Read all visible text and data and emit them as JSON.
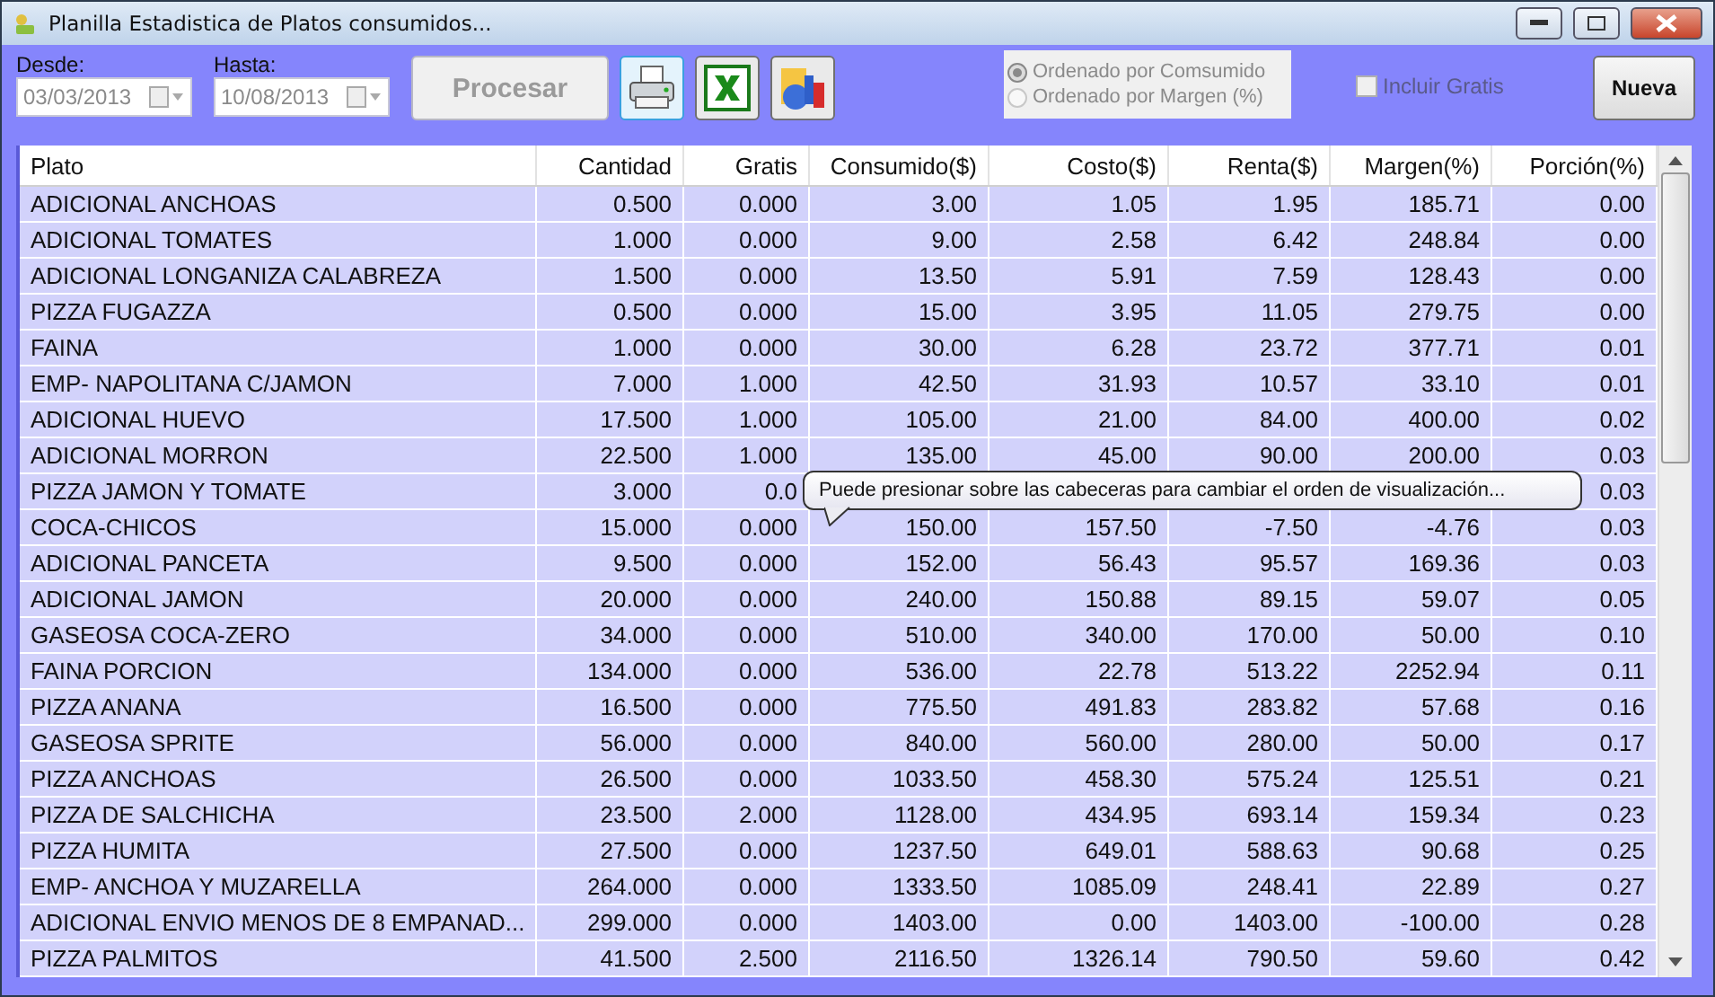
{
  "window": {
    "title": "Planilla Estadistica de Platos consumidos..."
  },
  "filters": {
    "from": {
      "label": "Desde:",
      "value": "03/03/2013",
      "disabled": true
    },
    "to": {
      "label": "Hasta:",
      "value": "10/08/2013",
      "disabled": true
    }
  },
  "process_button": {
    "label": "Procesar",
    "disabled": true
  },
  "tool_buttons": [
    {
      "kind": "print",
      "selected": true
    },
    {
      "kind": "excel",
      "selected": false
    },
    {
      "kind": "chart",
      "selected": false
    }
  ],
  "order_options": [
    {
      "label": "Ordenado por Comsumido",
      "selected": true
    },
    {
      "label": "Ordenado por Margen (%)",
      "selected": false
    }
  ],
  "include_free": {
    "label": "Incluir Gratis",
    "checked": false,
    "disabled": true
  },
  "new_button": {
    "label": "Nueva"
  },
  "table": {
    "columns": [
      "Plato",
      "Cantidad",
      "Gratis",
      "Consumido($)",
      "Costo($)",
      "Renta($)",
      "Margen(%)",
      "Porción(%)"
    ],
    "rows": [
      [
        "ADICIONAL ANCHOAS",
        "0.500",
        "0.000",
        "3.00",
        "1.05",
        "1.95",
        "185.71",
        "0.00"
      ],
      [
        "ADICIONAL TOMATES",
        "1.000",
        "0.000",
        "9.00",
        "2.58",
        "6.42",
        "248.84",
        "0.00"
      ],
      [
        "ADICIONAL LONGANIZA CALABREZA",
        "1.500",
        "0.000",
        "13.50",
        "5.91",
        "7.59",
        "128.43",
        "0.00"
      ],
      [
        "PIZZA FUGAZZA",
        "0.500",
        "0.000",
        "15.00",
        "3.95",
        "11.05",
        "279.75",
        "0.00"
      ],
      [
        "FAINA",
        "1.000",
        "0.000",
        "30.00",
        "6.28",
        "23.72",
        "377.71",
        "0.01"
      ],
      [
        "EMP- NAPOLITANA C/JAMON",
        "7.000",
        "1.000",
        "42.50",
        "31.93",
        "10.57",
        "33.10",
        "0.01"
      ],
      [
        "ADICIONAL HUEVO",
        "17.500",
        "1.000",
        "105.00",
        "21.00",
        "84.00",
        "400.00",
        "0.02"
      ],
      [
        "ADICIONAL MORRON",
        "22.500",
        "1.000",
        "135.00",
        "45.00",
        "90.00",
        "200.00",
        "0.03"
      ],
      [
        "PIZZA JAMON Y TOMATE",
        "3.000",
        "0.0",
        null,
        null,
        null,
        null,
        "0.03"
      ],
      [
        "COCA-CHICOS",
        "15.000",
        "0.000",
        "150.00",
        "157.50",
        "-7.50",
        "-4.76",
        "0.03"
      ],
      [
        "ADICIONAL PANCETA",
        "9.500",
        "0.000",
        "152.00",
        "56.43",
        "95.57",
        "169.36",
        "0.03"
      ],
      [
        "ADICIONAL JAMON",
        "20.000",
        "0.000",
        "240.00",
        "150.88",
        "89.15",
        "59.07",
        "0.05"
      ],
      [
        "GASEOSA COCA-ZERO",
        "34.000",
        "0.000",
        "510.00",
        "340.00",
        "170.00",
        "50.00",
        "0.10"
      ],
      [
        "FAINA PORCION",
        "134.000",
        "0.000",
        "536.00",
        "22.78",
        "513.22",
        "2252.94",
        "0.11"
      ],
      [
        "PIZZA ANANA",
        "16.500",
        "0.000",
        "775.50",
        "491.83",
        "283.82",
        "57.68",
        "0.16"
      ],
      [
        "GASEOSA SPRITE",
        "56.000",
        "0.000",
        "840.00",
        "560.00",
        "280.00",
        "50.00",
        "0.17"
      ],
      [
        "PIZZA ANCHOAS",
        "26.500",
        "0.000",
        "1033.50",
        "458.30",
        "575.24",
        "125.51",
        "0.21"
      ],
      [
        "PIZZA DE SALCHICHA",
        "23.500",
        "2.000",
        "1128.00",
        "434.95",
        "693.14",
        "159.34",
        "0.23"
      ],
      [
        "PIZZA HUMITA",
        "27.500",
        "0.000",
        "1237.50",
        "649.01",
        "588.63",
        "90.68",
        "0.25"
      ],
      [
        "EMP- ANCHOA Y MUZARELLA",
        "264.000",
        "0.000",
        "1333.50",
        "1085.09",
        "248.41",
        "22.89",
        "0.27"
      ],
      [
        "ADICIONAL ENVIO MENOS DE 8 EMPANAD...",
        "299.000",
        "0.000",
        "1403.00",
        "0.00",
        "1403.00",
        "-100.00",
        "0.28"
      ],
      [
        "PIZZA PALMITOS",
        "41.500",
        "2.500",
        "2116.50",
        "1326.14",
        "790.50",
        "59.60",
        "0.42"
      ]
    ]
  },
  "tooltip": {
    "text": "Puede presionar sobre las cabeceras para cambiar el orden de visualización..."
  }
}
